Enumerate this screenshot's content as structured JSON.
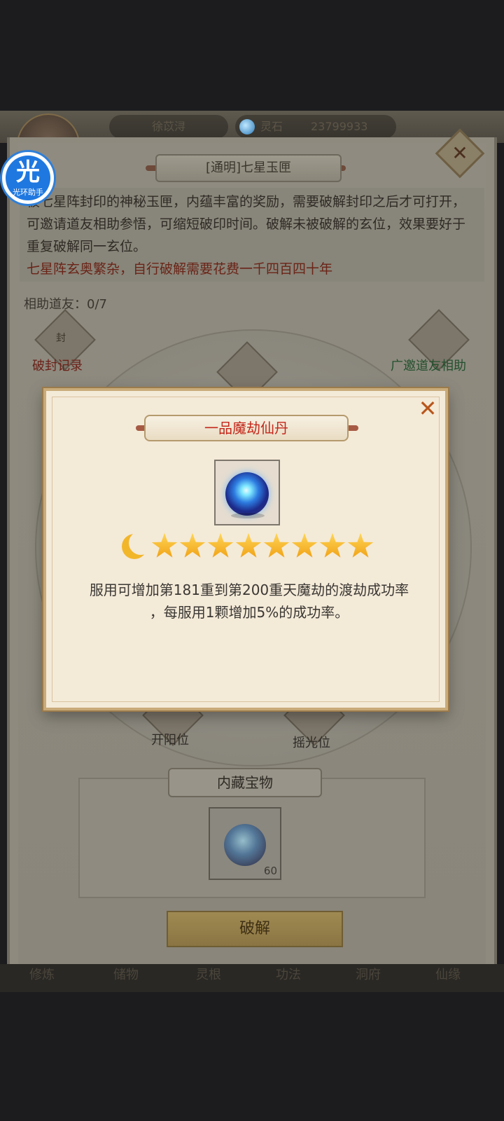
{
  "header": {
    "player_name": "徐苡浔",
    "currency_label": "灵石",
    "currency_value": "23799933"
  },
  "helper_app": {
    "glyph": "光",
    "caption": "光环助手"
  },
  "panel": {
    "title": "[通明]七星玉匣",
    "description": "被七星阵封印的神秘玉匣，内蕴丰富的奖励，需要破解封印之后才可打开，可邀请道友相助参悟，可缩短破印时间。破解未被破解的玄位，效果要好于重复破解同一玄位。",
    "warning": "七星阵玄奥繁杂，自行破解需要花费一千四百四十年",
    "helpers": "相助道友：0/7",
    "seal_record_label": "破封记录",
    "seal_icon_text": "封",
    "invite_label": "广邀道友相助",
    "slot_left": "开阳位",
    "slot_right": "摇光位",
    "treasure_title": "内藏宝物",
    "treasure_count": "60",
    "crack_button": "破解"
  },
  "bottom_nav": [
    "修炼",
    "储物",
    "灵根",
    "功法",
    "洞府",
    "仙缘"
  ],
  "modal": {
    "title": "一品魔劫仙丹",
    "item_name": "一品魔劫仙丹",
    "grade": {
      "moon": 1,
      "stars": 8
    },
    "effect_line1": "服用可增加第181重到第200重天魔劫的渡劫成功率",
    "effect_line2": "，每服用1颗增加5%的成功率。",
    "close_symbol": "✕"
  },
  "colors": {
    "modal_title": "#c3271b",
    "warning_text": "#6a2417",
    "invite_text": "#23502d",
    "star": "#f0a012"
  }
}
